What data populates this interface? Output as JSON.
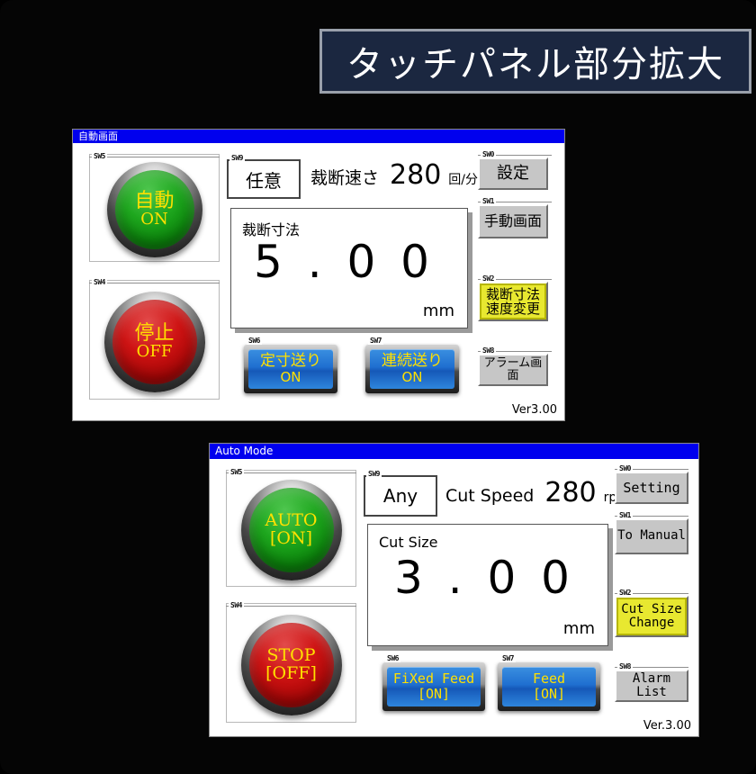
{
  "banner": {
    "text": "タッチパネル部分拡大"
  },
  "panels": [
    {
      "id": "jp",
      "title": "自動画面",
      "version": "Ver3.00",
      "lamps": [
        {
          "sw": "SW5",
          "line1": "自動",
          "line2": "ON",
          "color": "green"
        },
        {
          "sw": "SW4",
          "line1": "停止",
          "line2": "OFF",
          "color": "red"
        }
      ],
      "mode": {
        "sw": "SW9",
        "value": "任意"
      },
      "speed": {
        "label": "裁断速さ",
        "value": "280",
        "unit": "回/分"
      },
      "size": {
        "label": "裁断寸法",
        "value": "5 . 0 0",
        "unit": "mm"
      },
      "blue_buttons": [
        {
          "sw": "SW6",
          "line1": "定寸送り",
          "line2": "ON"
        },
        {
          "sw": "SW7",
          "line1": "連続送り",
          "line2": "ON"
        }
      ],
      "side_buttons": [
        {
          "sw": "SW0",
          "line1": "設定",
          "line2": "",
          "style": "gray"
        },
        {
          "sw": "SW1",
          "line1": "手動画面",
          "line2": "",
          "style": "gray"
        },
        {
          "sw": "SW2",
          "line1": "裁断寸法",
          "line2": "速度変更",
          "style": "yellow"
        },
        {
          "sw": "SW8",
          "line1": "アラーム画面",
          "line2": "",
          "style": "gray"
        }
      ]
    },
    {
      "id": "en",
      "title": "Auto Mode",
      "version": "Ver.3.00",
      "lamps": [
        {
          "sw": "SW5",
          "line1": "AUTO",
          "line2": "[ON]",
          "color": "green"
        },
        {
          "sw": "SW4",
          "line1": "STOP",
          "line2": "[OFF]",
          "color": "red"
        }
      ],
      "mode": {
        "sw": "SW9",
        "value": "Any"
      },
      "speed": {
        "label": "Cut Speed",
        "value": "280",
        "unit": "rpm"
      },
      "size": {
        "label": "Cut Size",
        "value": "3 . 0 0",
        "unit": "mm"
      },
      "blue_buttons": [
        {
          "sw": "SW6",
          "line1": "FiXed Feed",
          "line2": "[ON]"
        },
        {
          "sw": "SW7",
          "line1": "Feed",
          "line2": "[ON]"
        }
      ],
      "side_buttons": [
        {
          "sw": "SW0",
          "line1": "Setting",
          "line2": "",
          "style": "gray"
        },
        {
          "sw": "SW1",
          "line1": "To Manual",
          "line2": "",
          "style": "gray"
        },
        {
          "sw": "SW2",
          "line1": "Cut Size",
          "line2": "Change",
          "style": "yellow"
        },
        {
          "sw": "SW8",
          "line1": "Alarm List",
          "line2": "",
          "style": "gray"
        }
      ]
    }
  ],
  "colors": {
    "background": "#050505",
    "banner_bg": "#1b2740",
    "banner_border": "#9aa0ab",
    "titlebar": "#0000ee",
    "lamp_green": "#1fa81f",
    "lamp_red": "#cf1414",
    "button_blue": "#1f6fd0",
    "button_yellow": "#e8e830",
    "button_gray": "#c6c6c6",
    "lamp_text": "#ffe000"
  }
}
